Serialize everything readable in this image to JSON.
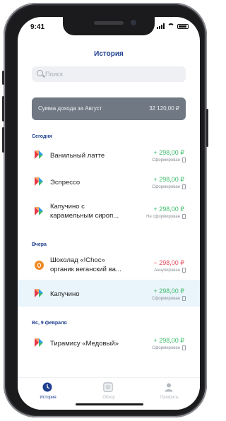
{
  "status_bar": {
    "time": "9:41"
  },
  "header": {
    "title": "История"
  },
  "search": {
    "placeholder": "Поиск"
  },
  "summary": {
    "label": "Сумма дохода за Август",
    "value": "32 120,00 ₽"
  },
  "sections": [
    {
      "title": "Сегодня"
    },
    {
      "title": "Вчера"
    },
    {
      "title": "Вс, 9 февраля"
    }
  ],
  "transactions": [
    {
      "title": "Ванильный латте",
      "amount": "+ 298,00 ₽",
      "status": "Сформирован",
      "logo": "brand-logo-icon",
      "type": "income"
    },
    {
      "title": "Эспрессо",
      "amount": "+ 298,00 ₽",
      "status": "Сформирован",
      "logo": "brand-logo-icon",
      "type": "income"
    },
    {
      "title": "Капучино с карамельным сиропом",
      "title_short": "Капучино с\nкарамельным сироп...",
      "amount": "+ 298,00 ₽",
      "status": "Не сформирован",
      "logo": "brand-logo-icon",
      "type": "income"
    },
    {
      "title": "Шоколад «!Choc» органик веганский ва...",
      "amount": "− 298,00 ₽",
      "status": "Аннулирован",
      "logo": "choc-logo-icon",
      "type": "refund"
    },
    {
      "title": "Капучино",
      "amount": "+ 298,00 ₽",
      "status": "Сформирован",
      "logo": "brand-logo-icon",
      "type": "income"
    },
    {
      "title": "Тирамису «Медовый»",
      "amount": "+ 298,00 ₽",
      "status": "Сформирован",
      "logo": "brand-logo-icon",
      "type": "income"
    }
  ],
  "tabbar": [
    {
      "label": "История",
      "icon": "clock-icon",
      "active": true
    },
    {
      "label": "Обзор",
      "icon": "grid-icon",
      "active": false
    },
    {
      "label": "Профиль",
      "icon": "user-icon",
      "active": false
    }
  ],
  "colors": {
    "accent": "#1f3f8f",
    "income": "#3dbb6a",
    "refund": "#e24b5a",
    "summary_bg": "#707883"
  }
}
